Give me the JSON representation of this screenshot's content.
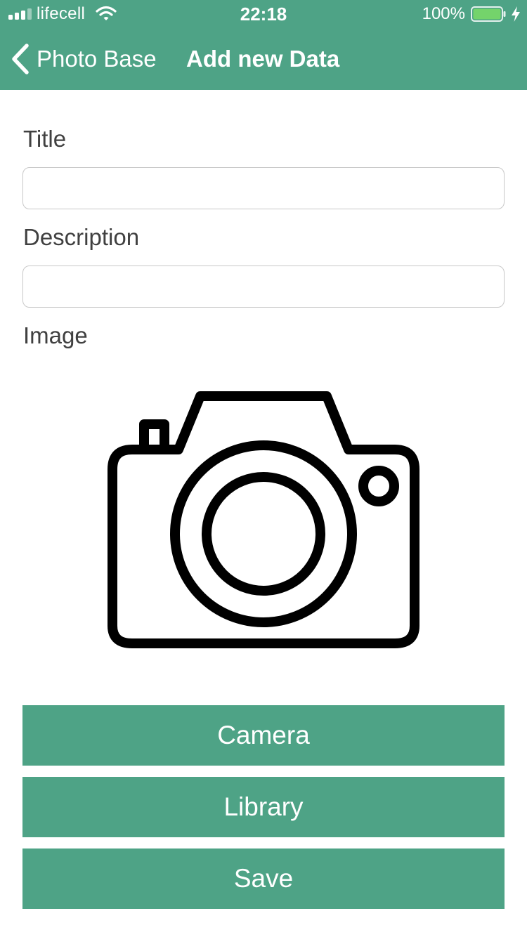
{
  "status_bar": {
    "carrier": "lifecell",
    "time": "22:18",
    "battery_percent": "100%",
    "battery_level": 1.0,
    "signal_bars": 4,
    "icons": [
      "signal-bars-icon",
      "wifi-icon",
      "battery-icon",
      "charging-bolt-icon"
    ]
  },
  "nav": {
    "back_label": "Photo Base",
    "title": "Add new Data",
    "back_icon": "chevron-left-icon"
  },
  "form": {
    "title_label": "Title",
    "title_value": "",
    "description_label": "Description",
    "description_value": "",
    "image_label": "Image",
    "image_placeholder_icon": "camera-icon"
  },
  "buttons": {
    "camera": "Camera",
    "library": "Library",
    "save": "Save"
  },
  "colors": {
    "accent": "#4ea386",
    "text_label": "#404040",
    "input_border": "#c8c8c8",
    "battery_fill": "#74d36b"
  }
}
